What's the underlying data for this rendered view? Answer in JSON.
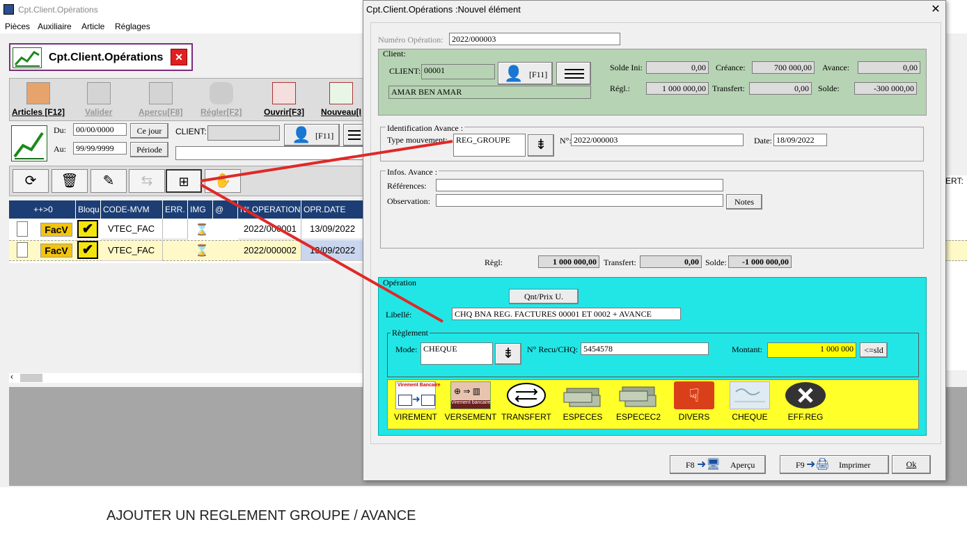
{
  "bg_app": {
    "title": "Cpt.Client.Opérations",
    "menu": [
      "Pièces",
      "Auxiliaire",
      "Article",
      "Réglages"
    ],
    "header_title": "Cpt.Client.Opérations",
    "toolbar": [
      {
        "label": "Articles [F12]"
      },
      {
        "label": "Valider"
      },
      {
        "label": "Aperçu[F8]"
      },
      {
        "label": "Régler[F2]"
      },
      {
        "label": "Ouvrir[F3]"
      },
      {
        "label": "Nouveau[I"
      }
    ],
    "filter": {
      "du_label": "Du:",
      "du_value": "00/00/0000",
      "au_label": "Au:",
      "au_value": "99/99/9999",
      "ce_jour": "Ce jour",
      "periode": "Période",
      "client_label": "CLIENT:",
      "f11": "[F11]"
    },
    "grid": {
      "headers": [
        "++>0",
        "Bloqu",
        "CODE-MVM",
        "ERR.",
        "IMG",
        "@",
        "N° OPERATION",
        "OPR.DATE"
      ],
      "rows": [
        {
          "type": "FacV",
          "code": "VTEC_FAC",
          "num": "2022/000001",
          "date": "13/09/2022"
        },
        {
          "type": "FacV",
          "code": "VTEC_FAC",
          "num": "2022/000002",
          "date": "13/09/2022"
        }
      ]
    },
    "right_fragment": "ERT:"
  },
  "dialog": {
    "title": "Cpt.Client.Opérations :Nouvel élément",
    "numero_label": "Numéro Opération:",
    "numero_value": "2022/000003",
    "client": {
      "group_title": "Client:",
      "code_label": "CLIENT:",
      "code_value": "00001",
      "f11": "[F11]",
      "name": "AMAR BEN AMAR",
      "solde_ini_label": "Solde Ini:",
      "solde_ini": "0,00",
      "creance_label": "Créance:",
      "creance": "700 000,00",
      "avance_label": "Avance:",
      "avance": "0,00",
      "regl_label": "Régl.:",
      "regl": "1 000 000,00",
      "transfert_label": "Transfert:",
      "transfert": "0,00",
      "solde_label": "Solde:",
      "solde": "-300 000,00"
    },
    "identification": {
      "group_title": "Identification Avance :",
      "type_label": "Type mouvement:",
      "type_value": "REG_GROUPE",
      "num_label": "N°:",
      "num_value": "2022/000003",
      "date_label": "Date:",
      "date_value": "18/09/2022"
    },
    "infos": {
      "group_title": "Infos. Avance :",
      "references_label": "Références:",
      "references_value": "",
      "observation_label": "Observation:",
      "observation_value": "",
      "notes_button": "Notes"
    },
    "totals": {
      "regl_label": "Règl:",
      "regl": "1 000 000,00",
      "transfert_label": "Transfert:",
      "transfert": "0,00",
      "solde_label": "Solde:",
      "solde": "-1 000 000,00"
    },
    "operation": {
      "group_title": "Opération",
      "qnt_button": "Qnt/Prix U.",
      "libelle_label": "Libellé:",
      "libelle_value": "CHQ BNA REG. FACTURES 00001 ET 0002 + AVANCE",
      "reglement_title": "Règlement",
      "mode_label": "Mode:",
      "mode_value": "CHEQUE",
      "recu_label": "N° Recu/CHQ:",
      "recu_value": "5454578",
      "montant_label": "Montant:",
      "montant_value": "1 000 000",
      "sld_button": "<=sld",
      "payment_modes": [
        "VIREMENT",
        "VERSEMENT",
        "TRANSFERT",
        "ESPECES",
        "ESPECEC2",
        "DIVERS",
        "CHEQUE",
        "EFF.REG"
      ],
      "virement_icon_text": "Virement Bancaire",
      "versement_icon_text": "Virement bancaire"
    },
    "footer": {
      "apercu_key": "F8",
      "apercu": "Aperçu",
      "imprimer_key": "F9",
      "imprimer": "Imprimer",
      "ok": "Ok"
    }
  },
  "caption": "AJOUTER UN REGLEMENT GROUPE / AVANCE",
  "colors": {
    "client_panel": "#b6d3b3",
    "operation_panel": "#22e6e6",
    "payment_bar": "#ffff2a",
    "montant": "#ffff00",
    "annotation_arrow": "#e02828",
    "grid_header": "#1c3e74"
  }
}
